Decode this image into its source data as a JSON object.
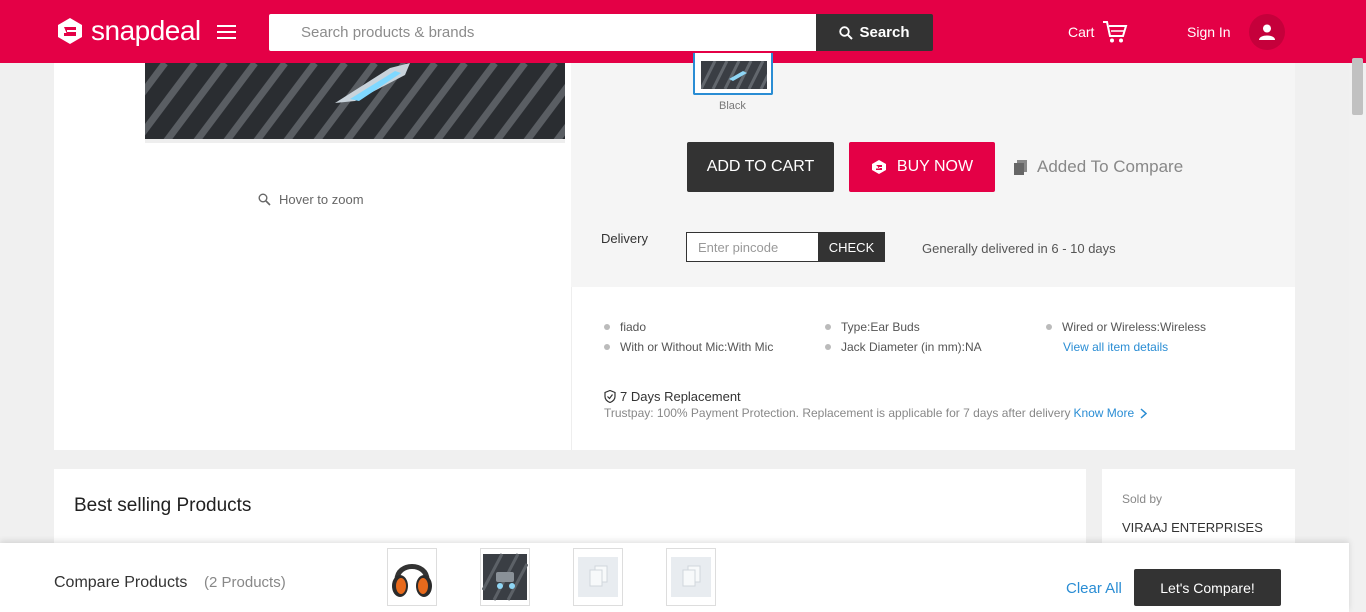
{
  "header": {
    "logo_text": "snapdeal",
    "search_placeholder": "Search products & brands",
    "search_button": "Search",
    "cart_label": "Cart",
    "signin_label": "Sign In",
    "brand_color": "#e40046"
  },
  "product": {
    "hover_zoom": "Hover to zoom",
    "color_option": "Black",
    "add_to_cart": "ADD TO CART",
    "buy_now": "BUY NOW",
    "compare_status": "Added To Compare"
  },
  "delivery": {
    "label": "Delivery",
    "pincode_placeholder": "Enter pincode",
    "check_button": "CHECK",
    "estimate": "Generally delivered in 6 - 10 days"
  },
  "highlights": {
    "items": [
      "fiado",
      "Type:Ear Buds",
      "Wired or Wireless:Wireless",
      "With or Without Mic:With Mic",
      "Jack Diameter (in mm):NA"
    ],
    "view_all": "View all item details"
  },
  "replacement": {
    "title": "7 Days Replacement",
    "detail": "Trustpay: 100% Payment Protection. Replacement is applicable for 7 days after delivery",
    "know_more": "Know More"
  },
  "best_selling": {
    "title": "Best selling Products"
  },
  "seller": {
    "label": "Sold by",
    "name": "VIRAAJ ENTERPRISES"
  },
  "compare_bar": {
    "title": "Compare Products",
    "count": "(2 Products)",
    "clear_all": "Clear All",
    "compare_button": "Let's Compare!"
  }
}
